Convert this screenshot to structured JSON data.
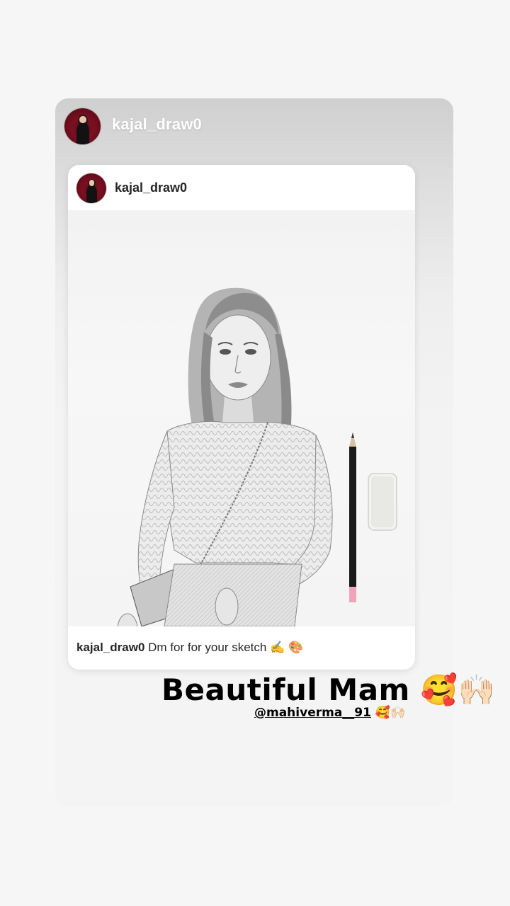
{
  "story": {
    "author": "kajal_draw0",
    "shared_post": {
      "author": "kajal_draw0",
      "caption_user": "kajal_draw0",
      "caption_text": "Dm for for your sketch ✍️ 🎨"
    },
    "overlay_text": "Beautiful Mam 🥰🙌🏻",
    "mention": {
      "handle": "@mahiverma__91",
      "emojis": "🥰🙌🏻"
    }
  },
  "icons": {
    "avatar": "profile-photo-icon",
    "sketch": "pencil-sketch-portrait",
    "pencil": "pencil-icon",
    "eraser": "eraser-icon"
  },
  "colors": {
    "avatar_bg": "#7d0f22",
    "text_dark": "#262626",
    "username_light": "#ffffff"
  }
}
